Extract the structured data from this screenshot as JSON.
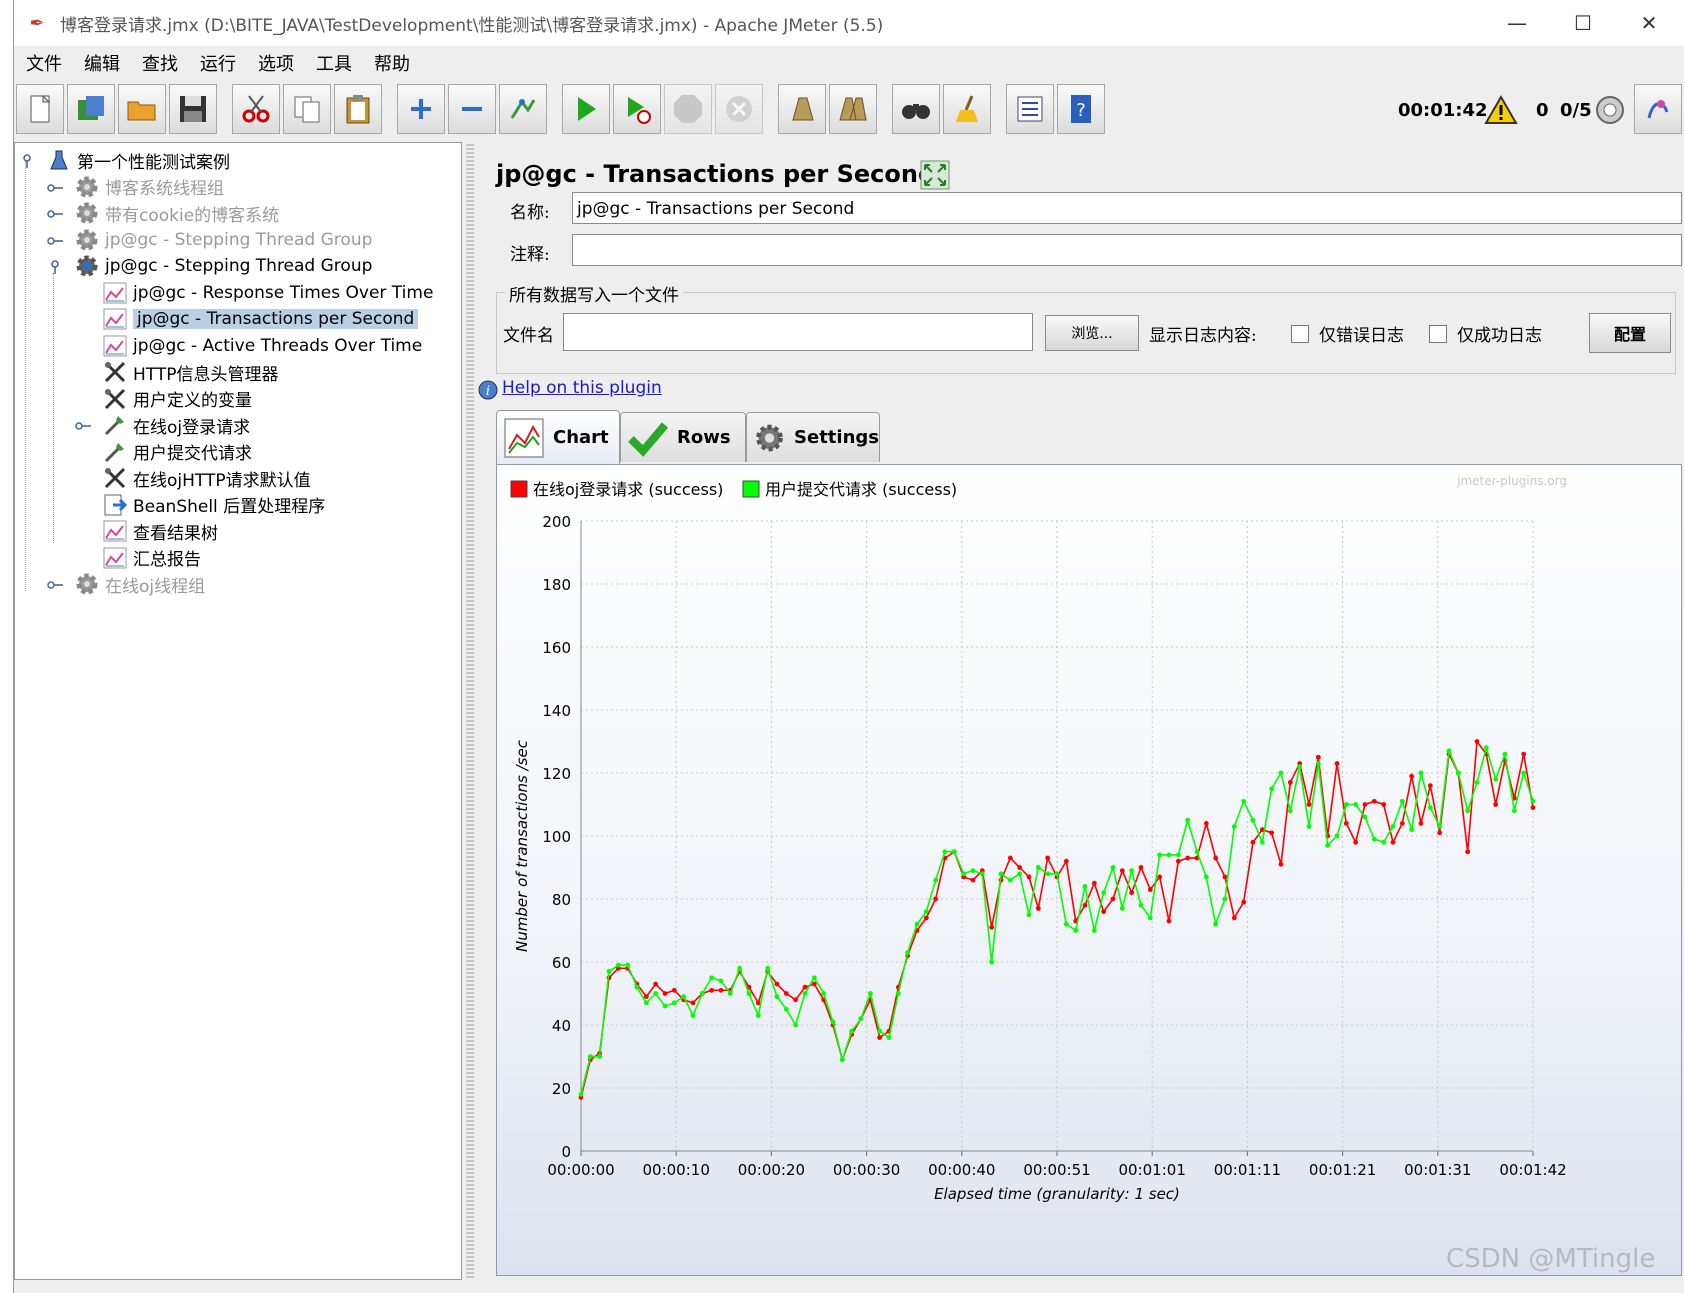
{
  "window": {
    "title": "博客登录请求.jmx (D:\\BITE_JAVA\\TestDevelopment\\性能测试\\博客登录请求.jmx) - Apache JMeter (5.5)",
    "minimize": "—",
    "maximize": "☐",
    "close": "✕"
  },
  "menu": [
    "文件",
    "编辑",
    "查找",
    "运行",
    "选项",
    "工具",
    "帮助"
  ],
  "toolbar": {
    "icons": [
      "new-icon",
      "templates-icon",
      "open-icon",
      "save-icon",
      "cut-icon",
      "copy-icon",
      "paste-icon",
      "expand-all-icon",
      "collapse-all-icon",
      "toggle-icon",
      "start-icon",
      "start-no-pauses-icon",
      "stop-icon",
      "shutdown-icon",
      "clear-icon",
      "clear-all-icon",
      "search-icon",
      "reset-search-icon",
      "function-helper-icon",
      "help-icon"
    ],
    "timer": "00:01:42",
    "error_count": "0",
    "threads": "0/5"
  },
  "tree": {
    "nodes": [
      {
        "label": "第一个性能测试案例",
        "level": 0,
        "icon": "test-plan-icon",
        "state": "normal"
      },
      {
        "label": "博客系统线程组",
        "level": 1,
        "icon": "thread-group-icon",
        "state": "disabled"
      },
      {
        "label": "带有cookie的博客系统",
        "level": 1,
        "icon": "thread-group-icon",
        "state": "disabled"
      },
      {
        "label": "jp@gc - Stepping Thread Group",
        "level": 1,
        "icon": "thread-group-icon",
        "state": "disabled"
      },
      {
        "label": "jp@gc - Stepping Thread Group",
        "level": 1,
        "icon": "thread-group-active-icon",
        "state": "normal"
      },
      {
        "label": "jp@gc - Response Times Over Time",
        "level": 2,
        "icon": "graph-listener-icon",
        "state": "normal"
      },
      {
        "label": "jp@gc - Transactions per Second",
        "level": 2,
        "icon": "graph-listener-icon",
        "state": "selected"
      },
      {
        "label": "jp@gc - Active Threads Over Time",
        "level": 2,
        "icon": "graph-listener-icon",
        "state": "normal"
      },
      {
        "label": "HTTP信息头管理器",
        "level": 2,
        "icon": "config-element-icon",
        "state": "normal"
      },
      {
        "label": "用户定义的变量",
        "level": 2,
        "icon": "config-element-icon",
        "state": "normal"
      },
      {
        "label": "在线oj登录请求",
        "level": 2,
        "icon": "sampler-icon",
        "state": "normal"
      },
      {
        "label": "用户提交代请求",
        "level": 2,
        "icon": "sampler-icon",
        "state": "normal"
      },
      {
        "label": "在线ojHTTP请求默认值",
        "level": 2,
        "icon": "config-element-icon",
        "state": "normal"
      },
      {
        "label": "BeanShell 后置处理程序",
        "level": 2,
        "icon": "post-processor-icon",
        "state": "normal"
      },
      {
        "label": "查看结果树",
        "level": 2,
        "icon": "graph-listener-icon",
        "state": "normal"
      },
      {
        "label": "汇总报告",
        "level": 2,
        "icon": "graph-listener-icon",
        "state": "normal"
      },
      {
        "label": "在线oj线程组",
        "level": 1,
        "icon": "thread-group-icon",
        "state": "disabled"
      }
    ]
  },
  "panel": {
    "title": "jp@gc - Transactions per Second",
    "name_label": "名称:",
    "name_value": "jp@gc - Transactions per Second",
    "comment_label": "注释:",
    "comment_value": "",
    "file_section_title": "所有数据写入一个文件",
    "filename_label": "文件名",
    "filename_value": "",
    "browse_button": "浏览...",
    "log_label": "显示日志内容:",
    "errors_only": "仅错误日志",
    "success_only": "仅成功日志",
    "configure_button": "配置",
    "help_link": "Help on this plugin",
    "tabs": [
      {
        "label": "Chart",
        "icon": "chart-icon",
        "active": true
      },
      {
        "label": "Rows",
        "icon": "checkmark-icon",
        "active": false
      },
      {
        "label": "Settings",
        "icon": "gear-icon",
        "active": false
      }
    ]
  },
  "watermark": "CSDN @MTingle",
  "chart_data": {
    "type": "line",
    "watermark": "jmeter-plugins.org",
    "xlabel": "Elapsed time (granularity: 1 sec)",
    "ylabel": "Number of transactions /sec",
    "ylim": [
      0,
      200
    ],
    "xlim_seconds": [
      0,
      102
    ],
    "yticks": [
      0,
      20,
      40,
      60,
      80,
      100,
      120,
      140,
      160,
      180,
      200
    ],
    "xtick_labels": [
      "00:00:00",
      "00:00:10",
      "00:00:20",
      "00:00:30",
      "00:00:40",
      "00:00:51",
      "00:01:01",
      "00:01:11",
      "00:01:21",
      "00:01:31",
      "00:01:42"
    ],
    "grid": true,
    "legend_position": "top-left",
    "series": [
      {
        "name": "在线oj登录请求 (success)",
        "color": "#ff0000",
        "values": [
          17,
          29,
          31,
          55,
          58,
          58,
          53,
          49,
          53,
          50,
          51,
          48,
          47,
          50,
          51,
          51,
          51,
          57,
          52,
          47,
          57,
          53,
          50,
          48,
          52,
          53,
          48,
          40,
          29,
          37,
          42,
          48,
          36,
          38,
          52,
          62,
          70,
          74,
          80,
          93,
          95,
          87,
          86,
          89,
          71,
          86,
          93,
          90,
          87,
          77,
          93,
          87,
          92,
          73,
          78,
          85,
          76,
          80,
          89,
          82,
          90,
          83,
          87,
          73,
          92,
          93,
          93,
          104,
          93,
          87,
          74,
          79,
          98,
          102,
          101,
          91,
          117,
          123,
          110,
          125,
          100,
          123,
          104,
          98,
          110,
          111,
          110,
          98,
          104,
          119,
          104,
          116,
          101,
          126,
          120,
          95,
          130,
          126,
          110,
          124,
          112,
          126,
          109
        ],
        "xstep_seconds": 1
      },
      {
        "name": "用户提交代请求 (success)",
        "color": "#00ff00",
        "values": [
          18,
          30,
          30,
          57,
          59,
          59,
          52,
          47,
          50,
          46,
          47,
          49,
          43,
          50,
          55,
          54,
          50,
          58,
          50,
          43,
          58,
          49,
          45,
          40,
          50,
          55,
          50,
          41,
          29,
          38,
          42,
          50,
          38,
          36,
          50,
          63,
          72,
          76,
          86,
          95,
          95,
          88,
          89,
          88,
          60,
          88,
          86,
          88,
          75,
          90,
          88,
          88,
          72,
          70,
          84,
          70,
          82,
          90,
          77,
          89,
          78,
          74,
          94,
          94,
          94,
          105,
          95,
          87,
          72,
          80,
          103,
          111,
          105,
          98,
          115,
          120,
          108,
          122,
          103,
          123,
          97,
          100,
          110,
          110,
          106,
          99,
          98,
          103,
          111,
          102,
          120,
          109,
          103,
          127,
          120,
          108,
          117,
          128,
          118,
          126,
          108,
          120,
          111
        ],
        "xstep_seconds": 1
      }
    ]
  }
}
